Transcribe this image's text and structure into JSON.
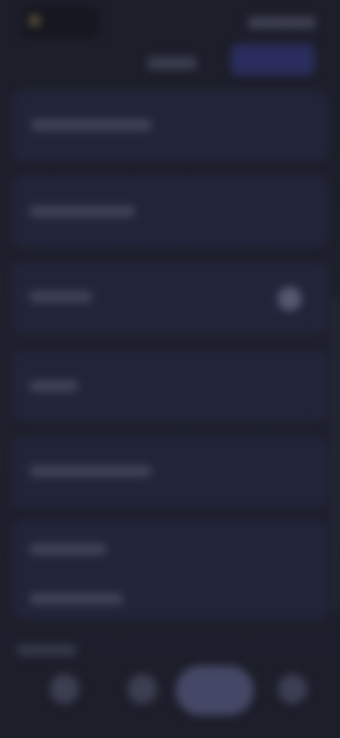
{
  "screen": {
    "background": "#1d1f2b",
    "accent": "#5a5d86"
  },
  "header": {
    "logo": "",
    "top_right_text": "",
    "tab_left": "",
    "tab_right": ""
  },
  "list": {
    "items": [
      {
        "label": ""
      },
      {
        "label": ""
      },
      {
        "label": ""
      },
      {
        "label": ""
      },
      {
        "label": ""
      },
      {
        "label": ""
      },
      {
        "label": ""
      }
    ]
  },
  "bottom": {
    "section_label": "",
    "nav_items": [
      {
        "label": "",
        "icon": "home-icon"
      },
      {
        "label": "",
        "icon": "list-icon"
      },
      {
        "label": "",
        "icon": "add-icon"
      },
      {
        "label": "",
        "icon": "profile-icon"
      }
    ]
  }
}
